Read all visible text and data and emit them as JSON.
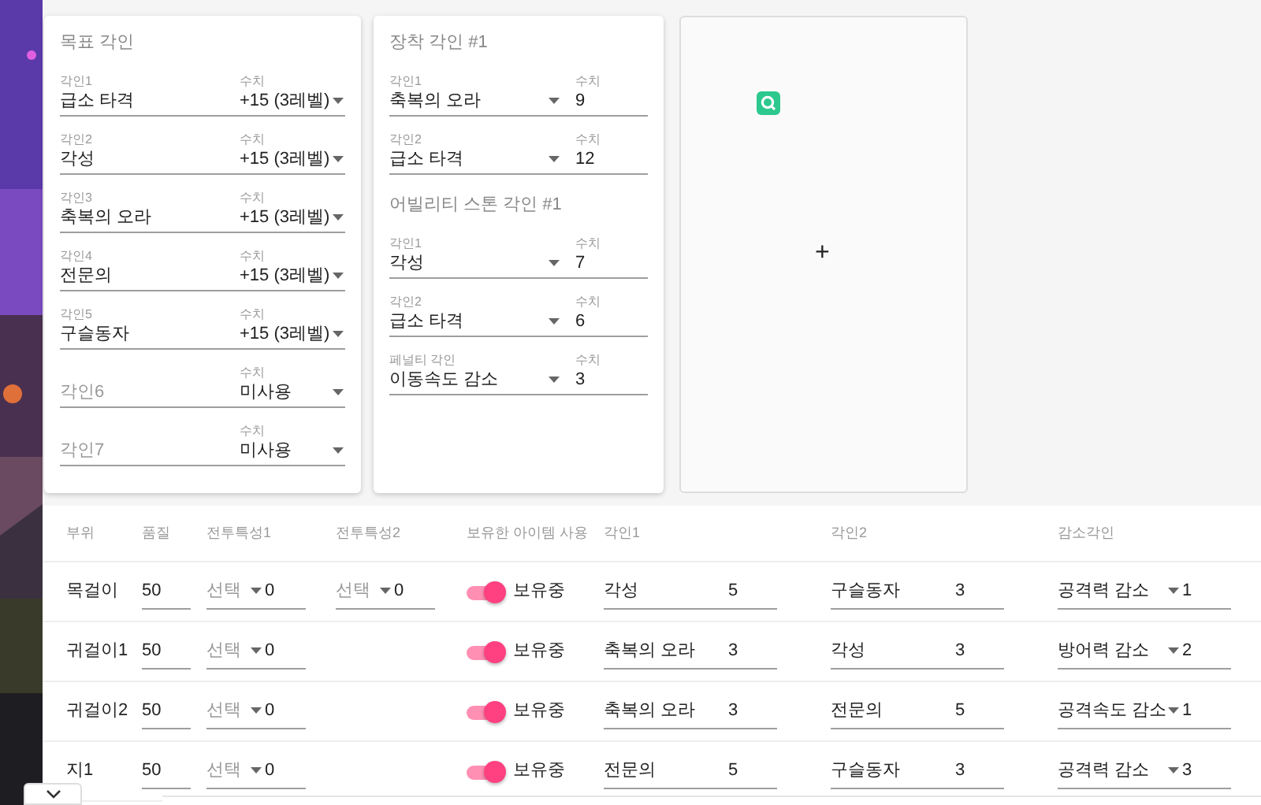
{
  "target_card": {
    "title": "목표 각인",
    "rows": [
      {
        "label": "각인1",
        "value": "급소 타격",
        "amount_label": "수치",
        "amount": "+15 (3레벨)"
      },
      {
        "label": "각인2",
        "value": "각성",
        "amount_label": "수치",
        "amount": "+15 (3레벨)"
      },
      {
        "label": "각인3",
        "value": "축복의 오라",
        "amount_label": "수치",
        "amount": "+15 (3레벨)"
      },
      {
        "label": "각인4",
        "value": "전문의",
        "amount_label": "수치",
        "amount": "+15 (3레벨)"
      },
      {
        "label": "각인5",
        "value": "구슬동자",
        "amount_label": "수치",
        "amount": "+15 (3레벨)"
      },
      {
        "placeholder": "각인6",
        "amount_label": "수치",
        "amount": "미사용"
      },
      {
        "placeholder": "각인7",
        "amount_label": "수치",
        "amount": "미사용"
      }
    ]
  },
  "equip_card": {
    "sections": [
      {
        "title": "장착 각인 #1",
        "rows": [
          {
            "label": "각인1",
            "value": "축복의 오라",
            "amount_label": "수치",
            "amount": "9"
          },
          {
            "label": "각인2",
            "value": "급소 타격",
            "amount_label": "수치",
            "amount": "12"
          }
        ]
      },
      {
        "title": "어빌리티 스톤 각인 #1",
        "rows": [
          {
            "label": "각인1",
            "value": "각성",
            "amount_label": "수치",
            "amount": "7"
          },
          {
            "label": "각인2",
            "value": "급소 타격",
            "amount_label": "수치",
            "amount": "6"
          },
          {
            "label": "페널티 각인",
            "value": "이동속도 감소",
            "amount_label": "수치",
            "amount": "3"
          }
        ]
      }
    ]
  },
  "add_card": {
    "symbol": "+"
  },
  "table": {
    "columns": [
      "부위",
      "품질",
      "전투특성1",
      "전투특성2",
      "보유한 아이템 사용",
      "각인1",
      "각인2",
      "감소각인"
    ],
    "rows": [
      {
        "part": "목걸이",
        "quality": "50",
        "trait1": {
          "placeholder": "선택",
          "value": "0"
        },
        "trait2": {
          "placeholder": "선택",
          "value": "0"
        },
        "owned": {
          "on": true,
          "label": "보유중"
        },
        "eng1": {
          "name": "각성",
          "level": "5"
        },
        "eng2": {
          "name": "구슬동자",
          "level": "3"
        },
        "penalty": {
          "name": "공격력 감소",
          "level": "1"
        }
      },
      {
        "part": "귀걸이1",
        "quality": "50",
        "trait1": {
          "placeholder": "선택",
          "value": "0"
        },
        "owned": {
          "on": true,
          "label": "보유중"
        },
        "eng1": {
          "name": "축복의 오라",
          "level": "3"
        },
        "eng2": {
          "name": "각성",
          "level": "3"
        },
        "penalty": {
          "name": "방어력 감소",
          "level": "2"
        }
      },
      {
        "part": "귀걸이2",
        "quality": "50",
        "trait1": {
          "placeholder": "선택",
          "value": "0"
        },
        "owned": {
          "on": true,
          "label": "보유중"
        },
        "eng1": {
          "name": "축복의 오라",
          "level": "3"
        },
        "eng2": {
          "name": "전문의",
          "level": "5"
        },
        "penalty": {
          "name": "공격속도 감소",
          "level": "1"
        }
      },
      {
        "part": "지1",
        "quality": "50",
        "trait1": {
          "placeholder": "선택",
          "value": "0"
        },
        "owned": {
          "on": true,
          "label": "보유중"
        },
        "eng1": {
          "name": "전문의",
          "level": "5"
        },
        "eng2": {
          "name": "구슬동자",
          "level": "3"
        },
        "penalty": {
          "name": "공격력 감소",
          "level": "3"
        }
      }
    ]
  }
}
